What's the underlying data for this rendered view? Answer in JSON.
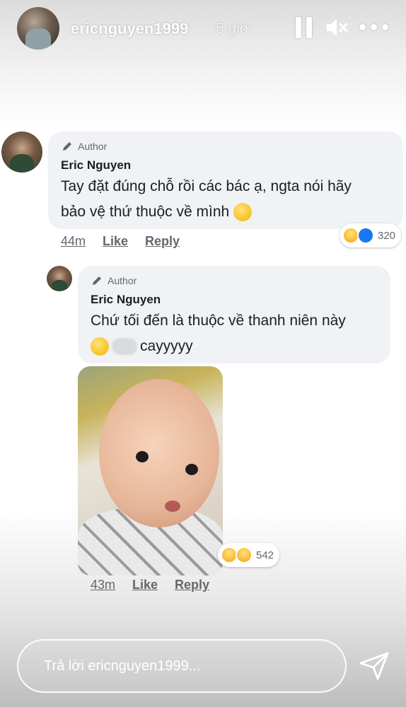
{
  "story": {
    "username": "ericnguyen1999",
    "time": "5 giờ",
    "pause_icon": "pause-icon",
    "mute_icon": "mute-icon",
    "more_icon": "more-icon"
  },
  "comments": [
    {
      "badge": "Author",
      "name": "Eric Nguyen",
      "text_line1": "Tay đặt đúng chỗ rồi các bác ạ, ngta nói hãy",
      "text_line2": "bảo vệ thứ thuộc về mình",
      "time": "44m",
      "like": "Like",
      "reply": "Reply",
      "reaction_count": "320"
    },
    {
      "badge": "Author",
      "name": "Eric Nguyen",
      "text_line1": "Chứ tối đến là thuộc về thanh niên này",
      "text_line2": "cayyyyy",
      "time": "43m",
      "like": "Like",
      "reply": "Reply",
      "reaction_count": "542"
    }
  ],
  "reply_bar": {
    "placeholder": "Trả lời ericnguyen1999...",
    "send_icon": "send-icon"
  },
  "colors": {
    "bubble": "#f0f2f5",
    "text": "#1c1e21",
    "muted": "#65676b",
    "like_blue": "#1877f2"
  }
}
